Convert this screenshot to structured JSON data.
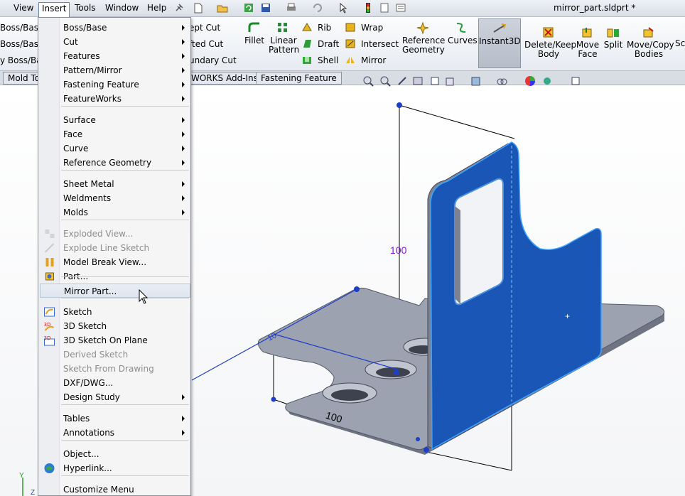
{
  "window": {
    "title": "mirror_part.sldprt *"
  },
  "menubar": {
    "items": [
      "View",
      "Insert",
      "Tools",
      "Window",
      "Help"
    ],
    "active": "Insert"
  },
  "left_strip": {
    "items": [
      "Boss/Base",
      "Boss/Base",
      "y Boss/Bas"
    ]
  },
  "ribbon": {
    "left_partial": [
      "ept Cut",
      "fted Cut",
      "undary Cut"
    ],
    "fillet": "Fillet",
    "linear_pattern": [
      "Linear",
      "Pattern"
    ],
    "rib": "Rib",
    "draft": "Draft",
    "shell": "Shell",
    "wrap": "Wrap",
    "intersect": "Intersect",
    "mirror": "Mirror",
    "reference_geometry": [
      "Reference",
      "Geometry"
    ],
    "curves": "Curves",
    "instant3d": "Instant3D",
    "delete_keep_body": [
      "Delete/Keep",
      "Body"
    ],
    "move_face": [
      "Move",
      "Face"
    ],
    "split": "Split",
    "move_copy_bodies": [
      "Move/Copy",
      "Bodies"
    ],
    "overflow": "Sc"
  },
  "tabs": [
    "Mold To",
    "WORKS Add-Ins",
    "Fastening Feature"
  ],
  "insert_menu": {
    "items": [
      {
        "label": "Boss/Base",
        "submenu": true,
        "disabled": false,
        "icon": "none"
      },
      {
        "label": "Cut",
        "submenu": true,
        "disabled": false,
        "icon": "none"
      },
      {
        "label": "Features",
        "submenu": true,
        "disabled": false,
        "icon": "none"
      },
      {
        "label": "Pattern/Mirror",
        "submenu": true,
        "disabled": false,
        "icon": "none"
      },
      {
        "label": "Fastening Feature",
        "submenu": true,
        "disabled": false,
        "icon": "none"
      },
      {
        "label": "FeatureWorks",
        "submenu": true,
        "disabled": false,
        "icon": "none"
      },
      {
        "label": "Surface",
        "submenu": true,
        "disabled": false,
        "icon": "none"
      },
      {
        "label": "Face",
        "submenu": true,
        "disabled": false,
        "icon": "none"
      },
      {
        "label": "Curve",
        "submenu": true,
        "disabled": false,
        "icon": "none"
      },
      {
        "label": "Reference Geometry",
        "submenu": true,
        "disabled": false,
        "icon": "none"
      },
      {
        "label": "Sheet Metal",
        "submenu": true,
        "disabled": false,
        "icon": "none"
      },
      {
        "label": "Weldments",
        "submenu": true,
        "disabled": false,
        "icon": "none"
      },
      {
        "label": "Molds",
        "submenu": true,
        "disabled": false,
        "icon": "none"
      },
      {
        "label": "Exploded View...",
        "submenu": false,
        "disabled": true,
        "icon": "exploded-view-icon"
      },
      {
        "label": "Explode Line Sketch",
        "submenu": false,
        "disabled": true,
        "icon": "explode-line-icon"
      },
      {
        "label": "Model Break View...",
        "submenu": false,
        "disabled": false,
        "icon": "model-break-icon"
      },
      {
        "label": "Part...",
        "submenu": false,
        "disabled": false,
        "icon": "part-icon"
      },
      {
        "label": "Mirror Part...",
        "submenu": false,
        "disabled": false,
        "icon": "none",
        "highlighted": true
      },
      {
        "label": "Sketch",
        "submenu": false,
        "disabled": false,
        "icon": "sketch-icon"
      },
      {
        "label": "3D Sketch",
        "submenu": false,
        "disabled": false,
        "icon": "3d-sketch-icon"
      },
      {
        "label": "3D Sketch On Plane",
        "submenu": false,
        "disabled": false,
        "icon": "3d-sketch-plane-icon"
      },
      {
        "label": "Derived Sketch",
        "submenu": false,
        "disabled": true,
        "icon": "none"
      },
      {
        "label": "Sketch From Drawing",
        "submenu": false,
        "disabled": true,
        "icon": "none"
      },
      {
        "label": "DXF/DWG...",
        "submenu": false,
        "disabled": false,
        "icon": "none"
      },
      {
        "label": "Design Study",
        "submenu": true,
        "disabled": false,
        "icon": "none"
      },
      {
        "label": "Tables",
        "submenu": true,
        "disabled": false,
        "icon": "none"
      },
      {
        "label": "Annotations",
        "submenu": true,
        "disabled": false,
        "icon": "none"
      },
      {
        "label": "Object...",
        "submenu": false,
        "disabled": false,
        "icon": "none"
      },
      {
        "label": "Hyperlink...",
        "submenu": false,
        "disabled": false,
        "icon": "hyperlink-icon"
      },
      {
        "label": "Customize Menu",
        "submenu": false,
        "disabled": false,
        "icon": "none"
      }
    ]
  },
  "model": {
    "dim_vertical": "100",
    "dim_bottom": "100",
    "dim_small": "10",
    "face_color": "#1a56b5",
    "plate_color": "#9da2b0"
  }
}
